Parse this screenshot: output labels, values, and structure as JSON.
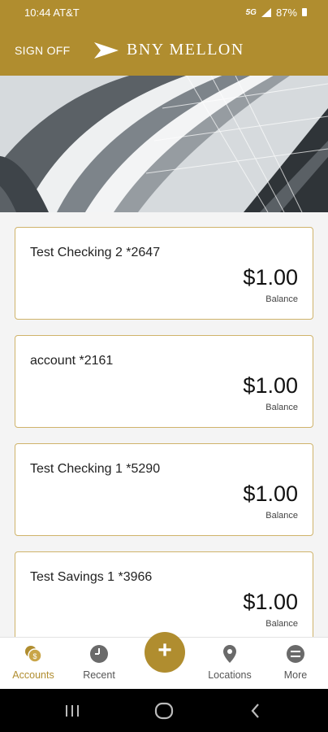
{
  "status_bar": {
    "time": "10:44 AT&T",
    "network": "5G",
    "battery": "87%"
  },
  "header": {
    "sign_off": "SIGN OFF",
    "logo_text": "BNY MELLON"
  },
  "accounts": [
    {
      "name": "Test Checking 2 *2647",
      "amount": "$1.00",
      "label": "Balance"
    },
    {
      "name": "account *2161",
      "amount": "$1.00",
      "label": "Balance"
    },
    {
      "name": "Test Checking 1 *5290",
      "amount": "$1.00",
      "label": "Balance"
    },
    {
      "name": "Test Savings 1 *3966",
      "amount": "$1.00",
      "label": "Balance"
    }
  ],
  "tab_bar": {
    "accounts": "Accounts",
    "recent": "Recent",
    "add_symbol": "+",
    "locations": "Locations",
    "more": "More"
  },
  "colors": {
    "brand_gold": "#b08d2f",
    "card_border": "#cfb36a"
  }
}
